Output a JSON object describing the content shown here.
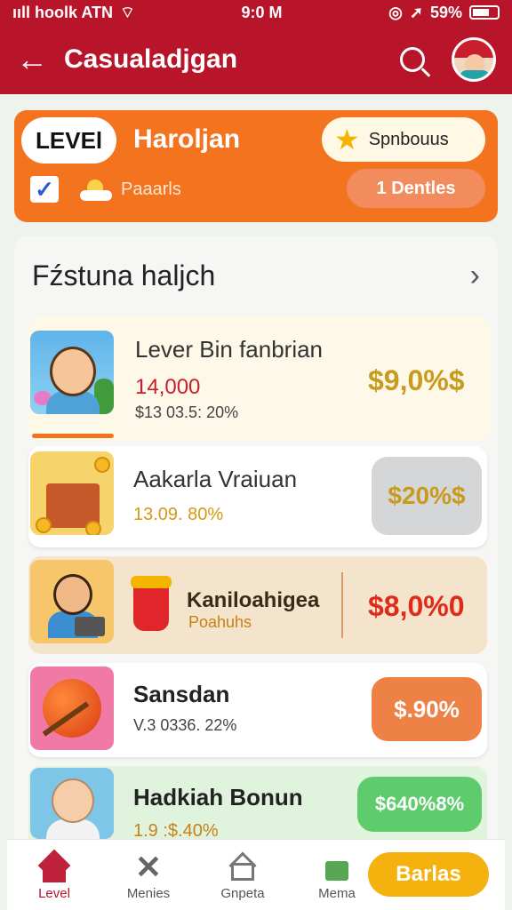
{
  "status_bar": {
    "carrier": "ııll hoolk ATN",
    "time": "9:0 M",
    "battery": "59%"
  },
  "header": {
    "title": "Casualadjgan"
  },
  "level_card": {
    "level_label": "LEVEl",
    "level_name": "Haroljan",
    "bonus_label": "Spnbouus",
    "parade_label": "Paaarls",
    "dentles_label": "1 Dentles"
  },
  "section": {
    "title": "Fźstuna haljch"
  },
  "items": [
    {
      "name": "Lever Bin fanbrian",
      "value": "14,000",
      "meta": "$13 03.5: 20%",
      "price": "$9,0%$"
    },
    {
      "name": "Aakarla Vraiuan",
      "meta": "13.09. 80%",
      "price": "$20%$"
    },
    {
      "name": "Kaniloahigea",
      "sub": "Poahuhs",
      "price": "$8,0%0"
    },
    {
      "name": "Sansdan",
      "meta": "V.3 0336. 22%",
      "price": "$.90%"
    },
    {
      "name": "Hadkiah Bonun",
      "meta": "1.9 :$.40%",
      "price": "$640%8%"
    }
  ],
  "bottom_nav": {
    "items": [
      {
        "label": "Level",
        "icon": "home-icon"
      },
      {
        "label": "Menies",
        "icon": "close-icon"
      },
      {
        "label": "Gnpeta",
        "icon": "house-outline-icon"
      },
      {
        "label": "Mema",
        "icon": "menu-icon"
      }
    ],
    "action_label": "Barlas"
  },
  "colors": {
    "header_red": "#b8142a",
    "level_orange": "#f4731e",
    "price_gold": "#c89a1e",
    "price_red": "#e02a1a"
  }
}
